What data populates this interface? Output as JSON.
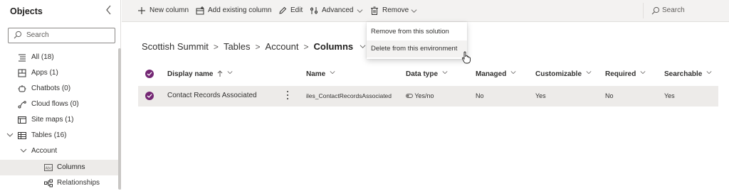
{
  "sidebar": {
    "title": "Objects",
    "search_placeholder": "Search",
    "items": [
      {
        "label": "All",
        "count": "(18)"
      },
      {
        "label": "Apps",
        "count": "(1)"
      },
      {
        "label": "Chatbots",
        "count": "(0)"
      },
      {
        "label": "Cloud flows",
        "count": "(0)"
      },
      {
        "label": "Site maps",
        "count": "(1)"
      },
      {
        "label": "Tables",
        "count": "(16)"
      },
      {
        "label": "Account",
        "count": ""
      },
      {
        "label": "Columns",
        "count": ""
      },
      {
        "label": "Relationships",
        "count": ""
      }
    ]
  },
  "toolbar": {
    "new_column": "New column",
    "add_existing_column": "Add existing column",
    "edit": "Edit",
    "advanced": "Advanced",
    "remove": "Remove",
    "search_placeholder": "Search"
  },
  "breadcrumb": {
    "items": [
      "Scottish Summit",
      "Tables",
      "Account"
    ],
    "current": "Columns"
  },
  "remove_menu": {
    "items": [
      "Remove from this solution",
      "Delete from this environment"
    ]
  },
  "table": {
    "headers": [
      "Display name",
      "Name",
      "Data type",
      "Managed",
      "Customizable",
      "Required",
      "Searchable"
    ],
    "rows": [
      {
        "display_name": "Contact Records Associated",
        "name": "iles_ContactRecordsAssociated",
        "data_type": "Yes/no",
        "managed": "No",
        "customizable": "Yes",
        "required": "No",
        "searchable": "Yes"
      }
    ]
  },
  "colors": {
    "accent": "#742774",
    "toolbar_bg": "#f3f2f1",
    "selected_bg": "#edebe9"
  }
}
